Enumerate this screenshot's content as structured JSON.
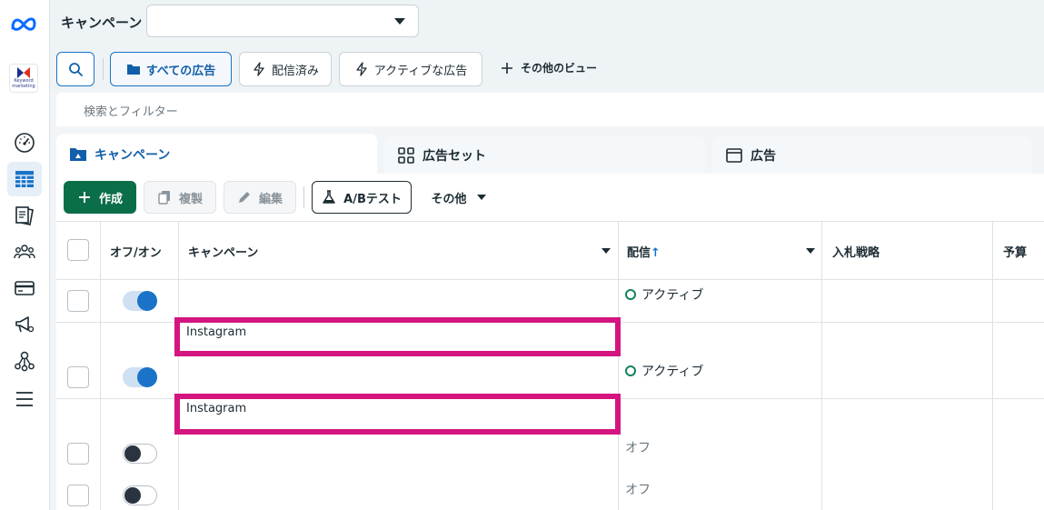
{
  "sidebar": {
    "logo_icon": "meta-logo-icon",
    "brand": {
      "line1": "Keyword",
      "line2": "marketing"
    },
    "items": [
      {
        "name": "dashboard",
        "icon": "gauge-icon"
      },
      {
        "name": "ads-manager",
        "icon": "table-icon",
        "active": true
      },
      {
        "name": "pages",
        "icon": "pages-icon"
      },
      {
        "name": "audiences",
        "icon": "people-icon"
      },
      {
        "name": "billing",
        "icon": "card-icon"
      },
      {
        "name": "campaign-planner",
        "icon": "megaphone-icon"
      },
      {
        "name": "events",
        "icon": "network-icon"
      },
      {
        "name": "menu",
        "icon": "menu-icon"
      }
    ]
  },
  "header": {
    "title": "キャンペーン",
    "select_value": ""
  },
  "views": {
    "search_icon": "search-icon",
    "all_ads": "すべての広告",
    "delivered": "配信済み",
    "active_ads": "アクティブな広告",
    "more_views": "その他のビュー"
  },
  "filter": {
    "placeholder": "検索とフィルター"
  },
  "tabs": [
    {
      "label": "キャンペーン",
      "icon": "folder-icon"
    },
    {
      "label": "広告セット",
      "icon": "grid-icon"
    },
    {
      "label": "広告",
      "icon": "window-icon"
    }
  ],
  "toolbar": {
    "create": "作成",
    "copy": "複製",
    "edit": "編集",
    "ab_test": "A/Bテスト",
    "other": "その他"
  },
  "table": {
    "headers": {
      "on_off": "オフ/オン",
      "campaign": "キャンペーン",
      "delivery": "配信",
      "delivery_sort": "↑",
      "bid_strategy": "入札戦略",
      "budget": "予算"
    },
    "rows": [
      {
        "toggle": "on",
        "campaign": "",
        "delivery": "アクティブ"
      },
      {
        "toggle": "on",
        "campaign": "Instagram",
        "delivery": "アクティブ"
      },
      {
        "toggle": "off",
        "campaign": "Instagram",
        "delivery": "オフ"
      },
      {
        "toggle": "off",
        "campaign": "",
        "delivery": "オフ"
      }
    ]
  },
  "colors": {
    "accent": "#1a73c8",
    "create_button": "#0a6e48",
    "highlight": "#d4147f",
    "active_status": "#11845b"
  }
}
